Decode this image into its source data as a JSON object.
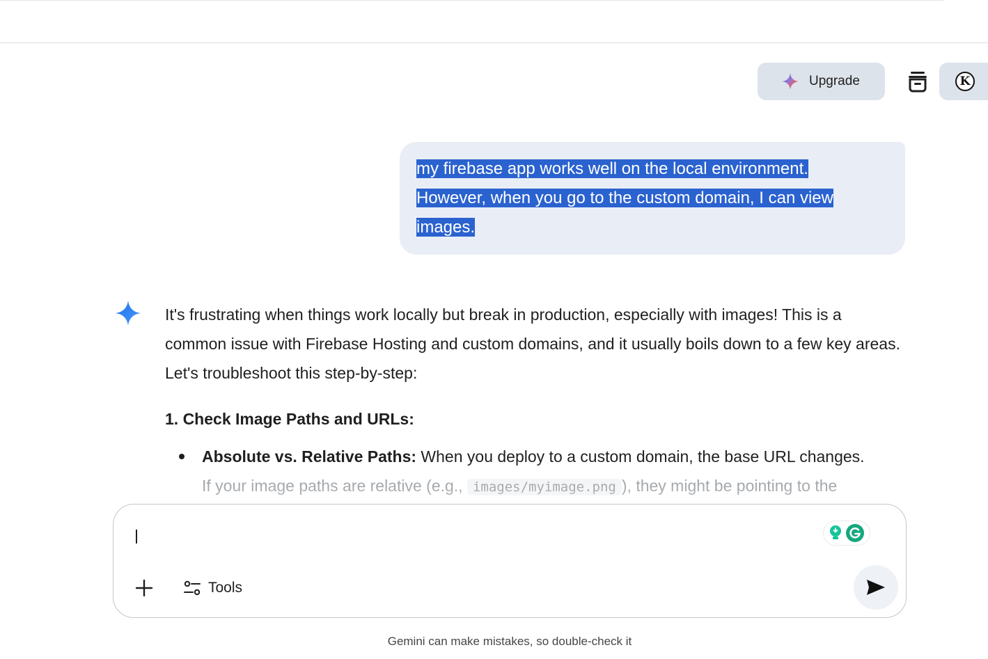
{
  "header": {
    "upgrade_label": "Upgrade",
    "avatar_letter": "K"
  },
  "conversation": {
    "user_message": {
      "lines": [
        "my firebase app works well on the local environment.",
        "However, when you go to the custom domain, I can view",
        "images."
      ]
    },
    "response": {
      "intro": "It's frustrating when things work locally but break in production, especially with images! This is a common issue with Firebase Hosting and custom domains, and it usually boils down to a few key areas. Let's troubleshoot this step-by-step:",
      "section_heading": "1. Check Image Paths and URLs:",
      "bullets": [
        {
          "bold": "Absolute vs. Relative Paths:",
          "text": " When you deploy to a custom domain, the base URL changes.",
          "faded_pre": "If your image paths are relative (e.g., ",
          "code": "images/myimage.png",
          "faded_post": "), they might be pointing to the"
        }
      ]
    }
  },
  "composer": {
    "tools_label": "Tools"
  },
  "footer": {
    "disclaimer": "Gemini can make mistakes, so double-check it"
  },
  "colors": {
    "selection": "#2a62cf",
    "user_bubble": "#e9eef6",
    "chip_bg": "#dde3ea",
    "grammarly_green": "#15c39a",
    "gemini_blue": "#4285f4"
  },
  "icons": {
    "upgrade": "sparkle-icon",
    "cleanup": "clear-history-icon",
    "assistant": "gemini-star-icon",
    "add": "plus-icon",
    "tools": "tools-sliders-icon",
    "send": "send-icon",
    "grammarly": "grammarly-icon"
  }
}
